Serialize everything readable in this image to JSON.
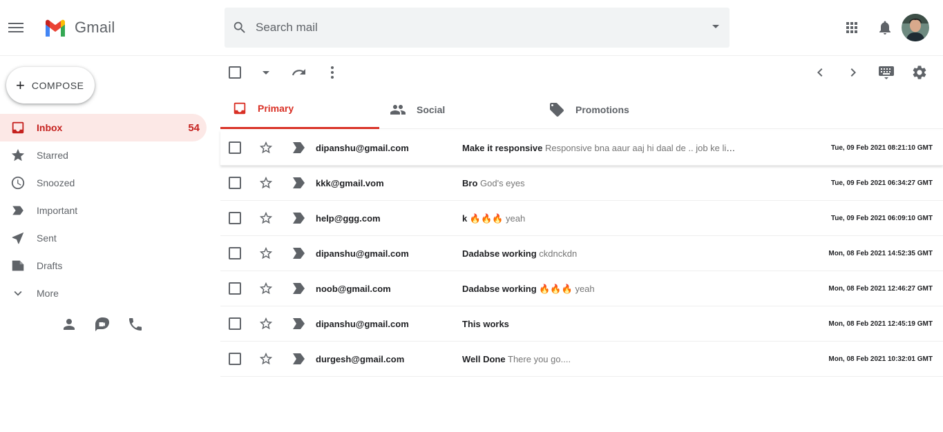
{
  "app": {
    "brand": "Gmail"
  },
  "search": {
    "placeholder": "Search mail"
  },
  "compose": {
    "label": "COMPOSE"
  },
  "sidebar": {
    "items": [
      {
        "label": "Inbox",
        "count": "54",
        "icon": "inbox-icon"
      },
      {
        "label": "Starred",
        "icon": "star-icon"
      },
      {
        "label": "Snoozed",
        "icon": "clock-icon"
      },
      {
        "label": "Important",
        "icon": "label-important-icon"
      },
      {
        "label": "Sent",
        "icon": "send-icon"
      },
      {
        "label": "Drafts",
        "icon": "draft-icon"
      },
      {
        "label": "More",
        "icon": "chevron-down-icon"
      }
    ]
  },
  "tabs": [
    {
      "label": "Primary",
      "icon": "inbox-icon"
    },
    {
      "label": "Social",
      "icon": "people-icon"
    },
    {
      "label": "Promotions",
      "icon": "tag-icon"
    }
  ],
  "emails": [
    {
      "sender": "dipanshu@gmail.com",
      "subject": "Make it responsive",
      "snippet": "Responsive bna aaur aaj hi daal de .. job ke liye...",
      "date": "Tue, 09 Feb 2021 08:21:10 GMT"
    },
    {
      "sender": "kkk@gmail.vom",
      "subject": "Bro",
      "snippet": "God's eyes",
      "date": "Tue, 09 Feb 2021 06:34:27 GMT"
    },
    {
      "sender": "help@ggg.com",
      "subject": "k 🔥🔥🔥",
      "snippet": "yeah",
      "date": "Tue, 09 Feb 2021 06:09:10 GMT"
    },
    {
      "sender": "dipanshu@gmail.com",
      "subject": "Dadabse working",
      "snippet": "ckdnckdn",
      "date": "Mon, 08 Feb 2021 14:52:35 GMT"
    },
    {
      "sender": "noob@gmail.com",
      "subject": "Dadabse working 🔥🔥🔥",
      "snippet": "yeah",
      "date": "Mon, 08 Feb 2021 12:46:27 GMT"
    },
    {
      "sender": "dipanshu@gmail.com",
      "subject": "This works",
      "snippet": "",
      "date": "Mon, 08 Feb 2021 12:45:19 GMT"
    },
    {
      "sender": "durgesh@gmail.com",
      "subject": "Well Done",
      "snippet": "There you go....",
      "date": "Mon, 08 Feb 2021 10:32:01 GMT"
    }
  ],
  "colors": {
    "accent": "#d93025",
    "inbox_bg": "#fce8e6",
    "icon": "#5f6368"
  }
}
